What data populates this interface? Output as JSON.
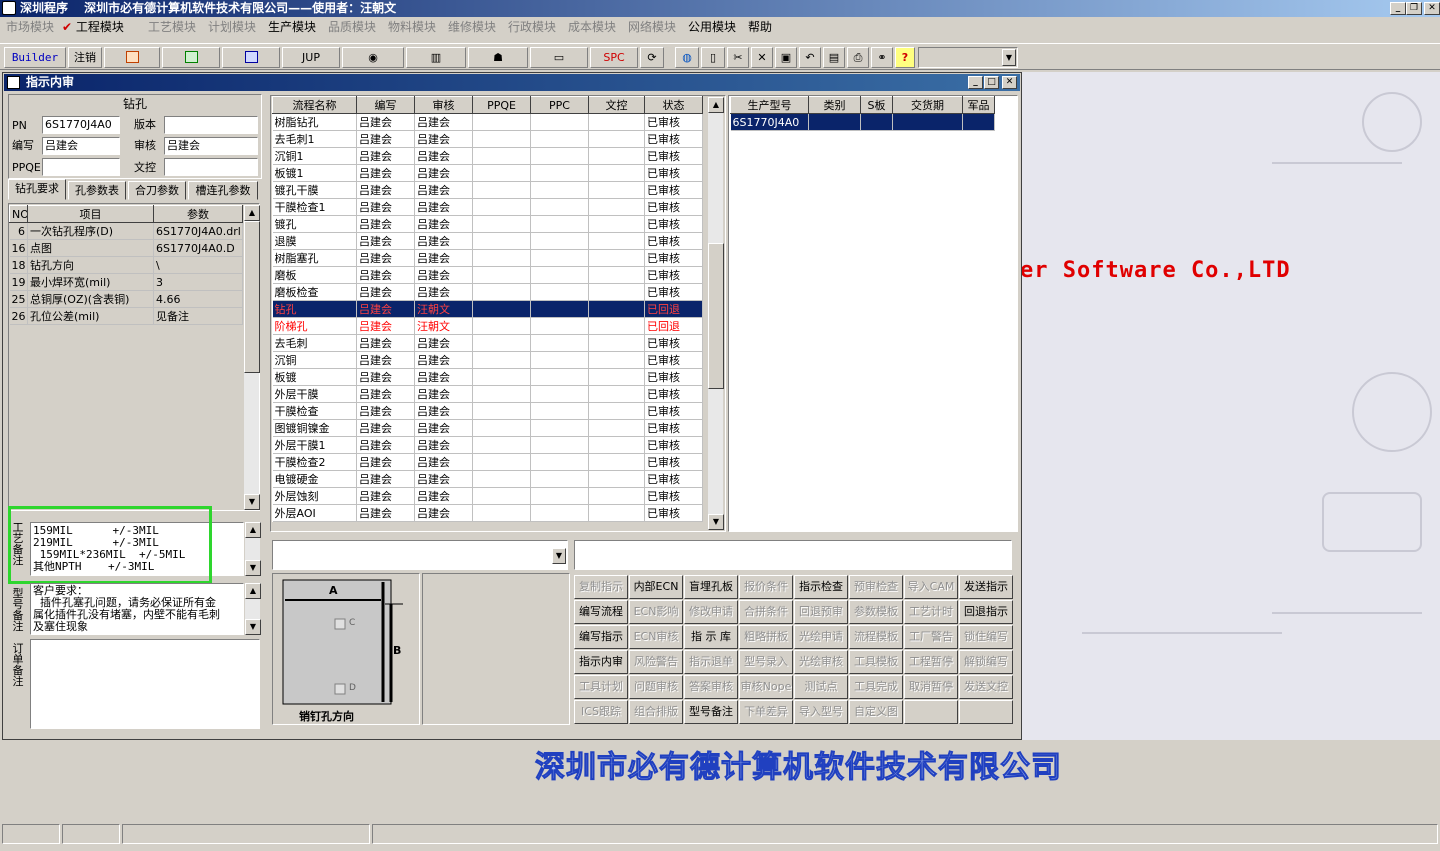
{
  "app": {
    "title": "深圳程序　 深圳市必有德计算机软件技术有限公司——使用者：汪朝文"
  },
  "menu": [
    {
      "label": "市场模块",
      "enabled": false
    },
    {
      "label": "工程模块",
      "enabled": true,
      "checked": true
    },
    {
      "label": "工艺模块",
      "enabled": false
    },
    {
      "label": "计划模块",
      "enabled": false
    },
    {
      "label": "生产模块",
      "enabled": true
    },
    {
      "label": "品质模块",
      "enabled": false
    },
    {
      "label": "物料模块",
      "enabled": false
    },
    {
      "label": "维修模块",
      "enabled": false
    },
    {
      "label": "行政模块",
      "enabled": false
    },
    {
      "label": "成本模块",
      "enabled": false
    },
    {
      "label": "网络模块",
      "enabled": false
    },
    {
      "label": "公用模块",
      "enabled": true
    },
    {
      "label": "帮助",
      "enabled": true
    }
  ],
  "toolbar": {
    "builder": "Builder",
    "logout": "注销",
    "jup": "JUP",
    "spc": "SPC"
  },
  "child": {
    "title": "指示内审"
  },
  "drill": {
    "heading": "钻孔",
    "pn_label": "PN",
    "pn": "6S1770J4A0",
    "version_label": "版本",
    "version": "",
    "author_label": "编写",
    "author": "吕建会",
    "review_label": "审核",
    "review": "吕建会",
    "ppqe_label": "PPQE",
    "ppqe": "",
    "doc_label": "文控",
    "doc": ""
  },
  "tabs": [
    "钻孔要求",
    "孔参数表",
    "合刀参数",
    "槽连孔参数"
  ],
  "params": {
    "headers": [
      "NO",
      "项目",
      "参数"
    ],
    "rows": [
      [
        "6",
        "一次钻孔程序(D)",
        "6S1770J4A0.drl"
      ],
      [
        "16",
        "点图",
        "6S1770J4A0.D"
      ],
      [
        "18",
        "钻孔方向",
        "\\"
      ],
      [
        "19",
        "最小焊环宽(mil)",
        "3"
      ],
      [
        "25",
        "总铜厚(OZ)(含表铜)",
        "4.66"
      ],
      [
        "26",
        "孔位公差(mil)",
        "见备注"
      ]
    ]
  },
  "craft_note": {
    "label": "工艺备注",
    "text": "159MIL      +/-3MIL\n219MIL      +/-3MIL\n 159MIL*236MIL  +/-5MIL\n其他NPTH    +/-3MIL"
  },
  "model_note": {
    "label": "型号备注",
    "text": "客户要求：\n  插件孔塞孔问题，请务必保证所有金\n属化插件孔没有堵塞，内壁不能有毛刺\n及塞住现象"
  },
  "order_note": {
    "label": "订单备注",
    "text": ""
  },
  "process": {
    "headers": [
      "流程名称",
      "编写",
      "审核",
      "PPQE",
      "PPC",
      "文控",
      "状态"
    ],
    "rows": [
      [
        "树脂钻孔",
        "吕建会",
        "吕建会",
        "",
        "",
        "",
        "已审核"
      ],
      [
        "去毛刺1",
        "吕建会",
        "吕建会",
        "",
        "",
        "",
        "已审核"
      ],
      [
        "沉铜1",
        "吕建会",
        "吕建会",
        "",
        "",
        "",
        "已审核"
      ],
      [
        "板镀1",
        "吕建会",
        "吕建会",
        "",
        "",
        "",
        "已审核"
      ],
      [
        "镀孔干膜",
        "吕建会",
        "吕建会",
        "",
        "",
        "",
        "已审核"
      ],
      [
        "干膜检查1",
        "吕建会",
        "吕建会",
        "",
        "",
        "",
        "已审核"
      ],
      [
        "镀孔",
        "吕建会",
        "吕建会",
        "",
        "",
        "",
        "已审核"
      ],
      [
        "退膜",
        "吕建会",
        "吕建会",
        "",
        "",
        "",
        "已审核"
      ],
      [
        "树脂塞孔",
        "吕建会",
        "吕建会",
        "",
        "",
        "",
        "已审核"
      ],
      [
        "磨板",
        "吕建会",
        "吕建会",
        "",
        "",
        "",
        "已审核"
      ],
      [
        "磨板检查",
        "吕建会",
        "吕建会",
        "",
        "",
        "",
        "已审核"
      ],
      [
        "钻孔",
        "吕建会",
        "汪朝文",
        "",
        "",
        "",
        "已回退"
      ],
      [
        "阶梯孔",
        "吕建会",
        "汪朝文",
        "",
        "",
        "",
        "已回退"
      ],
      [
        "去毛刺",
        "吕建会",
        "吕建会",
        "",
        "",
        "",
        "已审核"
      ],
      [
        "沉铜",
        "吕建会",
        "吕建会",
        "",
        "",
        "",
        "已审核"
      ],
      [
        "板镀",
        "吕建会",
        "吕建会",
        "",
        "",
        "",
        "已审核"
      ],
      [
        "外层干膜",
        "吕建会",
        "吕建会",
        "",
        "",
        "",
        "已审核"
      ],
      [
        "干膜检查",
        "吕建会",
        "吕建会",
        "",
        "",
        "",
        "已审核"
      ],
      [
        "图镀铜镍金",
        "吕建会",
        "吕建会",
        "",
        "",
        "",
        "已审核"
      ],
      [
        "外层干膜1",
        "吕建会",
        "吕建会",
        "",
        "",
        "",
        "已审核"
      ],
      [
        "干膜检查2",
        "吕建会",
        "吕建会",
        "",
        "",
        "",
        "已审核"
      ],
      [
        "电镀硬金",
        "吕建会",
        "吕建会",
        "",
        "",
        "",
        "已审核"
      ],
      [
        "外层蚀刻",
        "吕建会",
        "吕建会",
        "",
        "",
        "",
        "已审核"
      ],
      [
        "外层AOI",
        "吕建会",
        "吕建会",
        "",
        "",
        "",
        "已审核"
      ]
    ]
  },
  "products": {
    "headers": [
      "生产型号",
      "类别",
      "S板",
      "交货期",
      "军品"
    ],
    "rows": [
      [
        "6S1770J4A0",
        "",
        "",
        "",
        ""
      ]
    ]
  },
  "pin": {
    "label": "销钉孔方向",
    "a": "A",
    "b": "B",
    "c": "C",
    "d": "D"
  },
  "actions": [
    [
      "复制指示",
      "内部ECN",
      "盲埋孔板",
      "报价条件",
      "指示检查",
      "预审检查",
      "导入CAM",
      "发送指示"
    ],
    [
      "编写流程",
      "ECN影响",
      "修改申请",
      "合拼条件",
      "回退预审",
      "参数模板",
      "工艺计时",
      "回退指示"
    ],
    [
      "编写指示",
      "ECN审核",
      "指 示 库",
      "粗略拼板",
      "光绘申请",
      "流程模板",
      "工厂警告",
      "锁住编写"
    ],
    [
      "指示内审",
      "风险警告",
      "指示退单",
      "型号录入",
      "光绘审核",
      "工具模板",
      "工程暂停",
      "解锁编写"
    ],
    [
      "工具计划",
      "问题审核",
      "答案审核",
      "审核Nope",
      "测试点",
      "工具完成",
      "取消暂停",
      "发送文控"
    ],
    [
      "ICS跟踪",
      "组合排版",
      "型号备注",
      "下单差异",
      "导入型号",
      "自定义图",
      "",
      ""
    ]
  ],
  "actions_enabled": [
    [
      false,
      true,
      true,
      false,
      true,
      false,
      false,
      true
    ],
    [
      true,
      false,
      false,
      false,
      false,
      false,
      false,
      true
    ],
    [
      true,
      false,
      true,
      false,
      false,
      false,
      false,
      false
    ],
    [
      true,
      false,
      false,
      false,
      false,
      false,
      false,
      false
    ],
    [
      false,
      false,
      false,
      false,
      false,
      false,
      false,
      false
    ],
    [
      false,
      false,
      true,
      false,
      false,
      false,
      false,
      false
    ]
  ],
  "background": {
    "company": "深圳市必有德计算机软件技术有限公司",
    "software": "er Software Co.,LTD"
  }
}
